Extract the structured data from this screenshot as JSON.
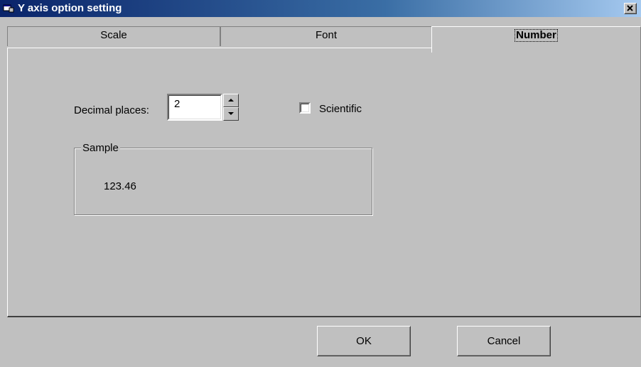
{
  "window": {
    "title": "Y axis option setting"
  },
  "tabs": [
    {
      "label": "Scale"
    },
    {
      "label": "Font"
    },
    {
      "label": "Number",
      "active": true
    }
  ],
  "number_tab": {
    "decimal_label": "Decimal places:",
    "decimal_value": "2",
    "scientific_label": "Scientific",
    "scientific_checked": false,
    "sample_title": "Sample",
    "sample_value": "123.46"
  },
  "buttons": {
    "ok": "OK",
    "cancel": "Cancel"
  },
  "colors": {
    "face": "#c0c0c0",
    "titlebar_start": "#0a246a",
    "titlebar_end": "#a6caf0"
  },
  "icons": {
    "app": "window-app-icon",
    "close": "close-x-icon",
    "spin_up": "up-arrow-icon",
    "spin_down": "down-arrow-icon"
  }
}
